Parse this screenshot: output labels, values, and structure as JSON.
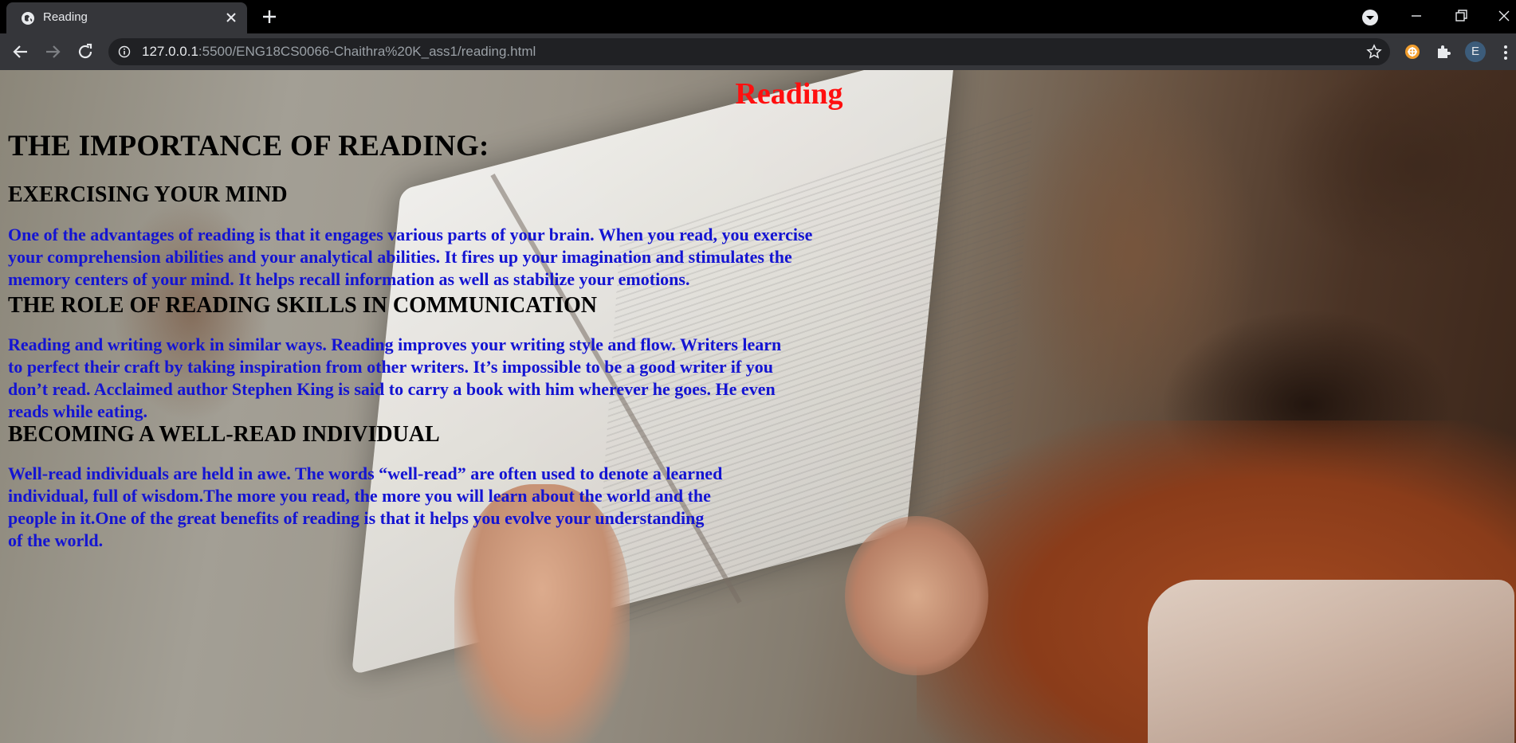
{
  "browser": {
    "tab_title": "Reading",
    "url_host": "127.0.0.1",
    "url_rest": ":5500/ENG18CS0066-Chaithra%20K_ass1/reading.html",
    "profile_initial": "E"
  },
  "page": {
    "title": "Reading",
    "main_heading": "THE IMPORTANCE OF READING:",
    "sections": [
      {
        "heading": "EXERCISING YOUR MIND",
        "lines": [
          "One of the advantages of reading is that it engages various parts of your brain. When you read, you exercise",
          "your comprehension abilities and your analytical abilities. It fires up your imagination and stimulates the",
          "memory centers of your mind. It helps recall information as well as stabilize your emotions."
        ]
      },
      {
        "heading": "THE ROLE OF READING SKILLS IN COMMUNICATION",
        "lines": [
          "Reading and writing work in similar ways. Reading improves your writing style and flow. Writers learn",
          "to perfect their craft by taking inspiration from other writers. It’s impossible to be a good writer if you",
          "don’t read. Acclaimed author Stephen King is said to carry a book with him wherever he goes. He even",
          "reads while eating."
        ]
      },
      {
        "heading": "BECOMING A WELL-READ INDIVIDUAL",
        "lines": [
          "Well-read individuals are held in awe. The words “well-read” are often used to denote a learned",
          "individual, full of wisdom.The more you read, the more you will learn about the world and the",
          "people in it.One of the great benefits of reading is that it helps you evolve your understanding",
          "of the world."
        ]
      }
    ]
  },
  "colors": {
    "title": "#ff0f0f",
    "heading": "#000000",
    "paragraph": "#1414d2"
  }
}
